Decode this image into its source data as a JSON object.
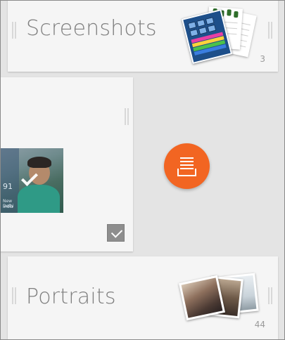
{
  "albums": [
    {
      "title": "Screenshots",
      "count": "3"
    },
    {
      "title": "Portraits",
      "count": "44"
    }
  ],
  "selected_photo": {
    "overlay_text_1": "91",
    "overlay_text_2": "New Delhi",
    "overlay_text_3": "India",
    "selected": true
  },
  "colors": {
    "accent": "#f26522",
    "card_background": "#f5f5f5",
    "page_background": "#e4e4e4",
    "title_text": "#7f7f7f"
  },
  "icons": {
    "fab": "stack-tray-icon",
    "selection": "checkmark-icon",
    "drag": "drag-handle-icon"
  }
}
